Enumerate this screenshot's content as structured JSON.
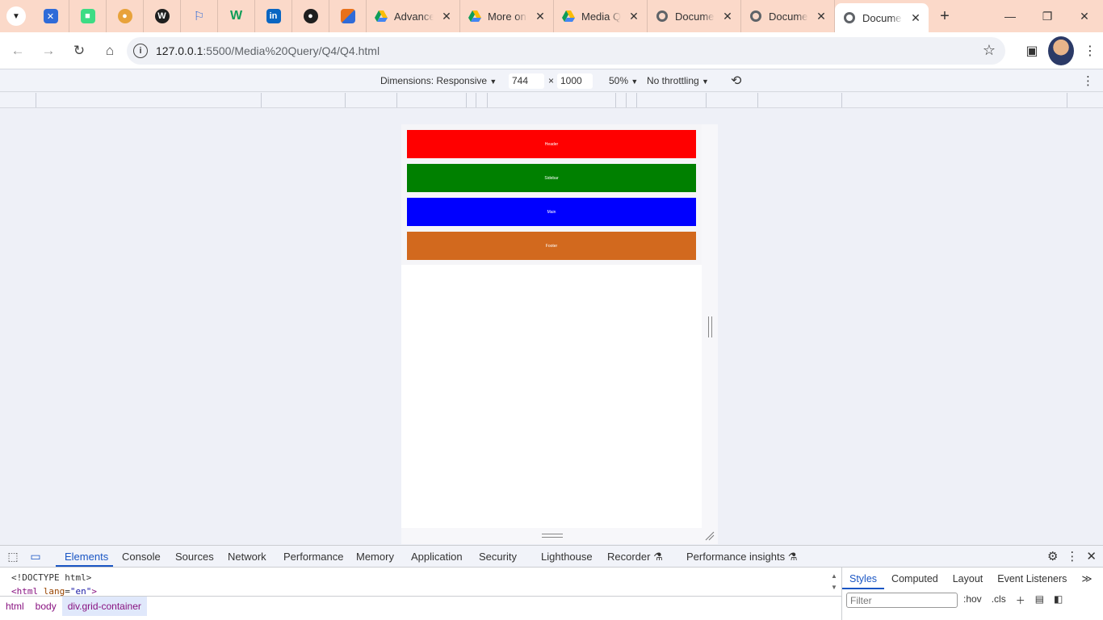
{
  "browser": {
    "pinned_tabs": [
      {
        "icon": "tool-icon",
        "color": "#2f6bd8"
      },
      {
        "icon": "android-icon",
        "color": "#3ddc84"
      },
      {
        "icon": "duck-icon",
        "color": "#e8a23a"
      },
      {
        "icon": "wordpress-icon",
        "color": "#1f1f1f"
      },
      {
        "icon": "flag-icon",
        "color": "#2f6bd8"
      },
      {
        "icon": "w-icon",
        "color": "#0f9d58"
      },
      {
        "icon": "linkedin-icon",
        "color": "#0a66c2"
      },
      {
        "icon": "github-icon",
        "color": "#1f1f1f"
      },
      {
        "icon": "puzzle-icon",
        "color": "#e8711a"
      }
    ],
    "tabs": [
      {
        "title": "Advance",
        "icon": "google-drive-icon",
        "active": false
      },
      {
        "title": "More on",
        "icon": "google-drive-icon",
        "active": false
      },
      {
        "title": "Media Q",
        "icon": "google-drive-icon",
        "active": false
      },
      {
        "title": "Docume",
        "icon": "globe-icon",
        "active": false
      },
      {
        "title": "Docume",
        "icon": "globe-icon",
        "active": false
      },
      {
        "title": "Docume",
        "icon": "globe-icon",
        "active": true
      }
    ],
    "url_host": "127.0.0.1",
    "url_rest": ":5500/Media%20Query/Q4/Q4.html"
  },
  "device_toolbar": {
    "dimensions_label": "Dimensions: Responsive",
    "width": "744",
    "times": "×",
    "height": "1000",
    "zoom": "50%",
    "throttling": "No throttling"
  },
  "page": {
    "blocks": [
      {
        "label": "Header",
        "color": "#ff0000"
      },
      {
        "label": "Sidebar",
        "color": "#008000"
      },
      {
        "label": "Main",
        "color": "#0000ff"
      },
      {
        "label": "Footer",
        "color": "#d2691e"
      }
    ]
  },
  "devtools": {
    "tabs": [
      "Elements",
      "Console",
      "Sources",
      "Network",
      "Performance",
      "Memory",
      "Application",
      "Security",
      "Lighthouse",
      "Recorder",
      "Performance insights"
    ],
    "code_line1": "<!DOCTYPE html>",
    "code_tag_open": "<html",
    "code_attr": "lang",
    "code_eq": "=",
    "code_val": "\"en\"",
    "code_tag_close": ">",
    "breadcrumbs": [
      "html",
      "body",
      "div.grid-container"
    ],
    "styles_tabs": [
      "Styles",
      "Computed",
      "Layout",
      "Event Listeners"
    ],
    "more_tabs": "≫",
    "filter_placeholder": "Filter",
    "hov": ":hov",
    "cls": ".cls"
  }
}
